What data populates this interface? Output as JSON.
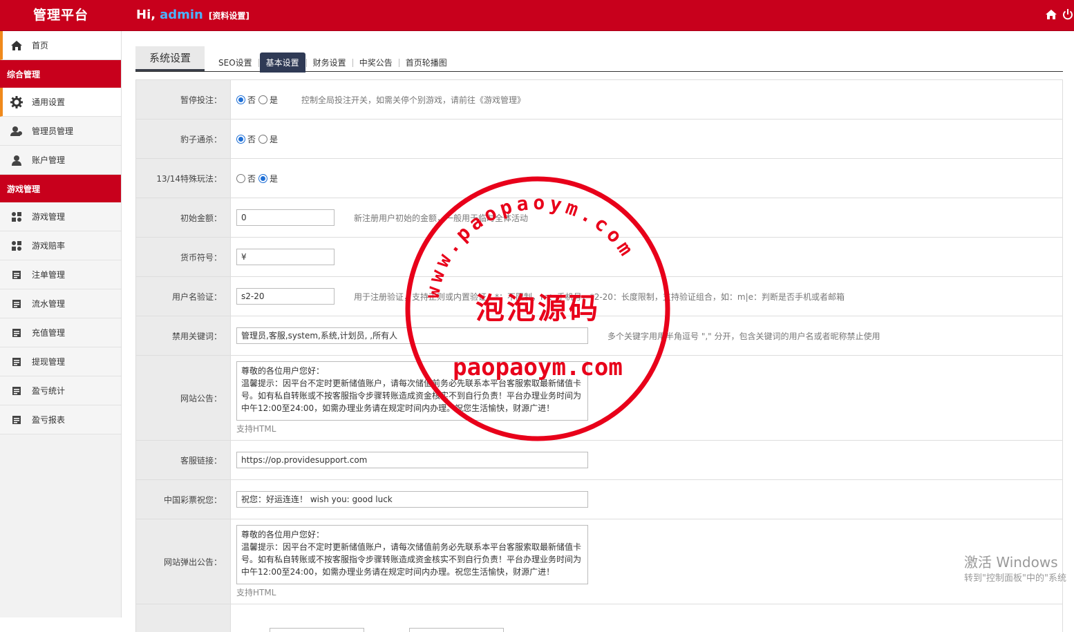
{
  "header": {
    "brand": "管理平台",
    "hi": "Hi,",
    "user": "admin",
    "profile_link": "[资料设置]",
    "icons": [
      "home-icon",
      "power-icon"
    ]
  },
  "sidebar": {
    "home": "首页",
    "section1": "综合管理",
    "general_settings": "通用设置",
    "admin_mgmt": "管理员管理",
    "account_mgmt": "账户管理",
    "section2": "游戏管理",
    "game_mgmt": "游戏管理",
    "game_odds": "游戏赔率",
    "bet_mgmt": "注单管理",
    "flow_mgmt": "流水管理",
    "recharge_mgmt": "充值管理",
    "withdraw_mgmt": "提现管理",
    "profit_stats": "盈亏统计",
    "profit_report": "盈亏报表"
  },
  "tabs": {
    "title": "系统设置",
    "items": [
      "SEO设置",
      "基本设置",
      "财务设置",
      "中奖公告",
      "首页轮播图"
    ],
    "selected": "基本设置"
  },
  "form": {
    "pause_bet": {
      "label": "暂停投注：",
      "opt_no": "否",
      "opt_yes": "是",
      "selected": "否",
      "hint": "控制全局投注开关，如需关停个别游戏，请前往《游戏管理》"
    },
    "leopard": {
      "label": "豹子通杀：",
      "opt_no": "否",
      "opt_yes": "是",
      "selected": "否"
    },
    "special_play": {
      "label": "13/14特殊玩法：",
      "opt_no": "否",
      "opt_yes": "是",
      "selected": "是"
    },
    "initial_amount": {
      "label": "初始金额：",
      "value": "0",
      "hint": "新注册用户初始的金额，一般用于临时全体活动"
    },
    "currency": {
      "label": "货币符号：",
      "value": "¥"
    },
    "username_check": {
      "label": "用户名验证：",
      "value": "s2-20",
      "hint": "用于注册验证，支持正则或内置验证，*：不限制，m：手机号，*2-20：长度限制，支持验证组合，如：m|e：判断是否手机或者邮箱"
    },
    "banned_words": {
      "label": "禁用关键词：",
      "value": "管理员,客服,system,系统,计划员, ,所有人",
      "hint": "多个关键字用用半角逗号 \",\" 分开，包含关键词的用户名或者昵称禁止使用"
    },
    "notice": {
      "label": "网站公告：",
      "value": "尊敬的各位用户您好：\n温馨提示：因平台不定时更新储值账户，请每次储值前务必先联系本平台客服索取最新储值卡号。如有私自转账或不按客服指令步骤转账造成资金核实不到自行负责！平台办理业务时间为中午12:00至24:00，如需办理业务请在规定时间内办理。祝您生活愉快，财源广进！",
      "sub": "支持HTML"
    },
    "service_link": {
      "label": "客服链接：",
      "value": "https://op.providesupport.com"
    },
    "lottery_wish": {
      "label": "中国彩票祝您：",
      "value": "祝您：好运连连！ wish you: good luck"
    },
    "popup_notice": {
      "label": "网站弹出公告：",
      "value": "尊敬的各位用户您好：\n温馨提示：因平台不定时更新储值账户，请每次储值前务必先联系本平台客服索取最新储值卡号。如有私自转账或不按客服指令步骤转账造成资金核实不到自行负责！平台办理业务时间为中午12:00至24:00，如需办理业务请在规定时间内办理。祝您生活愉快，财源广进！",
      "sub": "支持HTML"
    }
  },
  "seal": {
    "url_arc": "www.paopaoym.com",
    "name": "泡泡源码",
    "domain": "paopaoym.com"
  },
  "os_watermark": {
    "line1": "激活 Windows",
    "line2": "转到\"控制面板\"中的\"系统"
  },
  "colors": {
    "header_bg": "#c8001c",
    "accent_orange": "#f08a1c",
    "tab_selected": "#2f3a55",
    "radio": "#1e6fd6",
    "seal_red": "#e8001a"
  }
}
